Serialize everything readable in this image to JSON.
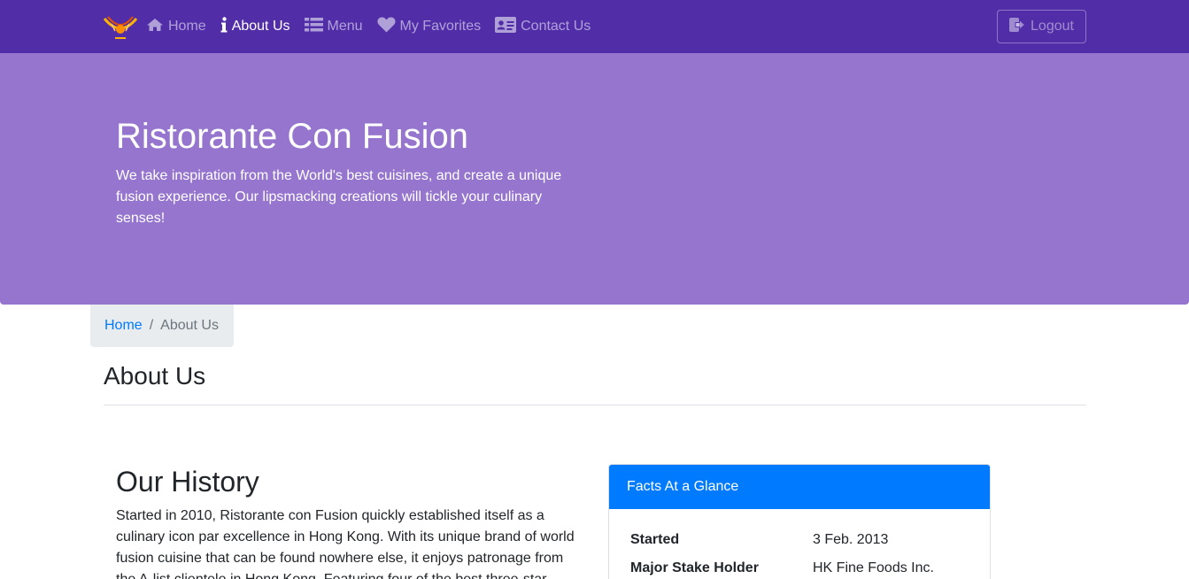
{
  "navbar": {
    "brand_logo": "restaurant-logo-icon",
    "items": [
      {
        "label": "Home",
        "icon": "home-icon",
        "active": false
      },
      {
        "label": "About Us",
        "icon": "info-icon",
        "active": true
      },
      {
        "label": "Menu",
        "icon": "list-icon",
        "active": false
      },
      {
        "label": "My Favorites",
        "icon": "heart-icon",
        "active": false
      },
      {
        "label": "Contact Us",
        "icon": "address-card-icon",
        "active": false
      }
    ],
    "logout_label": "Logout",
    "logout_icon": "sign-out-icon"
  },
  "jumbotron": {
    "title": "Ristorante Con Fusion",
    "text": "We take inspiration from the World's best cuisines, and create a unique fusion experience. Our lipsmacking creations will tickle your culinary senses!"
  },
  "breadcrumb": {
    "home": "Home",
    "separator": "/",
    "current": "About Us"
  },
  "page": {
    "title": "About Us"
  },
  "history": {
    "title": "Our History",
    "text": "Started in 2010, Ristorante con Fusion quickly established itself as a culinary icon par excellence in Hong Kong. With its unique brand of world fusion cuisine that can be found nowhere else, it enjoys patronage from the A-list clientele in Hong Kong. Featuring four of the best three-star"
  },
  "facts": {
    "header": "Facts At a Glance",
    "rows": [
      {
        "term": "Started",
        "value": "3 Feb. 2013"
      },
      {
        "term": "Major Stake Holder",
        "value": "HK Fine Foods Inc."
      }
    ]
  },
  "colors": {
    "navbar": "#512da8",
    "jumbotron": "#9575cd",
    "card_header": "#007bff",
    "link": "#007bff"
  }
}
